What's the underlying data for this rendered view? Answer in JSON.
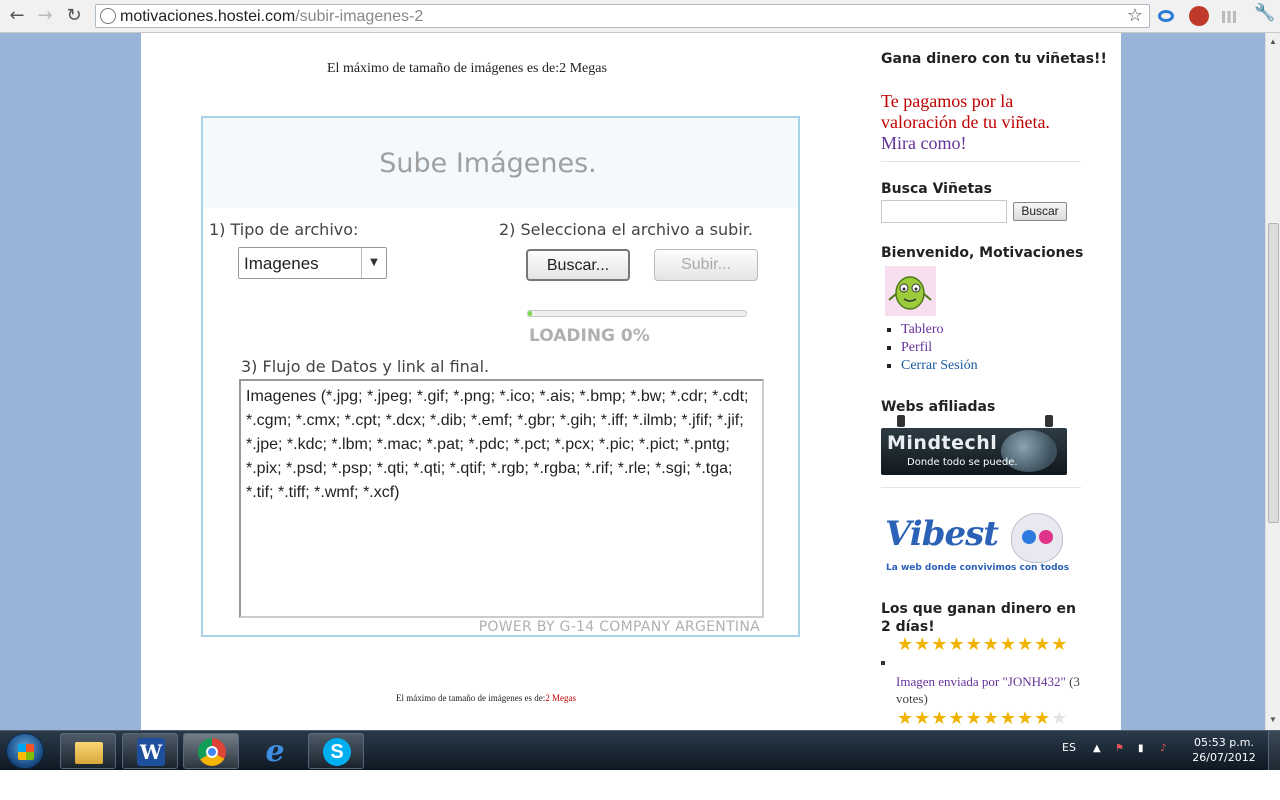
{
  "browser": {
    "url_domain": "motivaciones.hostei.com",
    "url_path": "/subir-imagenes-2",
    "nav_icons": [
      "back-icon",
      "forward-icon",
      "reload-icon"
    ]
  },
  "page": {
    "max_size_top": "El máximo de tamaño de imágenes es de:2 Megas",
    "max_size_bottom_prefix": "El máximo de tamaño de imágenes es de:",
    "max_size_bottom_value": "2 Megas"
  },
  "uploader": {
    "title": "Sube Imágenes.",
    "step1_label": "1) Tipo de archivo:",
    "file_type_value": "Imagenes",
    "step2_label": "2) Selecciona el archivo a subir.",
    "browse_button": "Buscar...",
    "upload_button": "Subir...",
    "progress_percent": 2,
    "loading_text": "LOADING 0%",
    "step3_label": "3) Flujo de Datos y link al final.",
    "flow_text": "Imagenes (*.jpg; *.jpeg; *.gif; *.png; *.ico; *.ais; *.bmp; *.bw; *.cdr; *.cdt; *.cgm; *.cmx; *.cpt; *.dcx; *.dib; *.emf; *.gbr; *.gih; *.iff; *.ilmb; *.jfif; *.jif; *.jpe; *.kdc; *.lbm; *.mac; *.pat; *.pdc; *.pct; *.pcx; *.pic; *.pict; *.pntg; *.pix; *.psd; *.psp; *.qti; *.qti; *.qtif; *.rgb; *.rgba; *.rif; *.rle; *.sgi; *.tga; *.tif; *.tiff; *.wmf; *.xcf)",
    "powered_by": "POWER BY G-14 COMPANY ARGENTINA"
  },
  "sidebar": {
    "earn_title": "Gana dinero con tu viñetas!!",
    "promo_text": "Te pagamos por la valoración de tu viñeta.",
    "promo_link": "Mira como!",
    "search_title": "Busca Viñetas",
    "search_value": "",
    "search_button": "Buscar",
    "welcome_title": "Bienvenido, Motivaciones",
    "links": [
      {
        "label": "Tablero"
      },
      {
        "label": "Perfil"
      },
      {
        "label": "Cerrar Sesión"
      }
    ],
    "affiliates_title": "Webs afiliadas",
    "mindtech_name": "Mindtechl",
    "mindtech_slogan": "Donde todo se puede.",
    "vibest_name": "Vibest",
    "vibest_tagline": "La web donde convivimos con todos",
    "winners_title": "Los que ganan dinero en 2 días!",
    "first_rating_stars": 10,
    "vote_text": "Imagen enviada por \"JONH432\"",
    "vote_count": "(3 votes)",
    "second_rating_stars": 9.5
  },
  "taskbar": {
    "apps": [
      "windows-explorer-icon",
      "word-icon",
      "chrome-icon",
      "internet-explorer-icon",
      "skype-icon"
    ],
    "active_app": "chrome-icon",
    "language": "ES",
    "time": "05:53 p.m.",
    "date": "26/07/2012"
  }
}
